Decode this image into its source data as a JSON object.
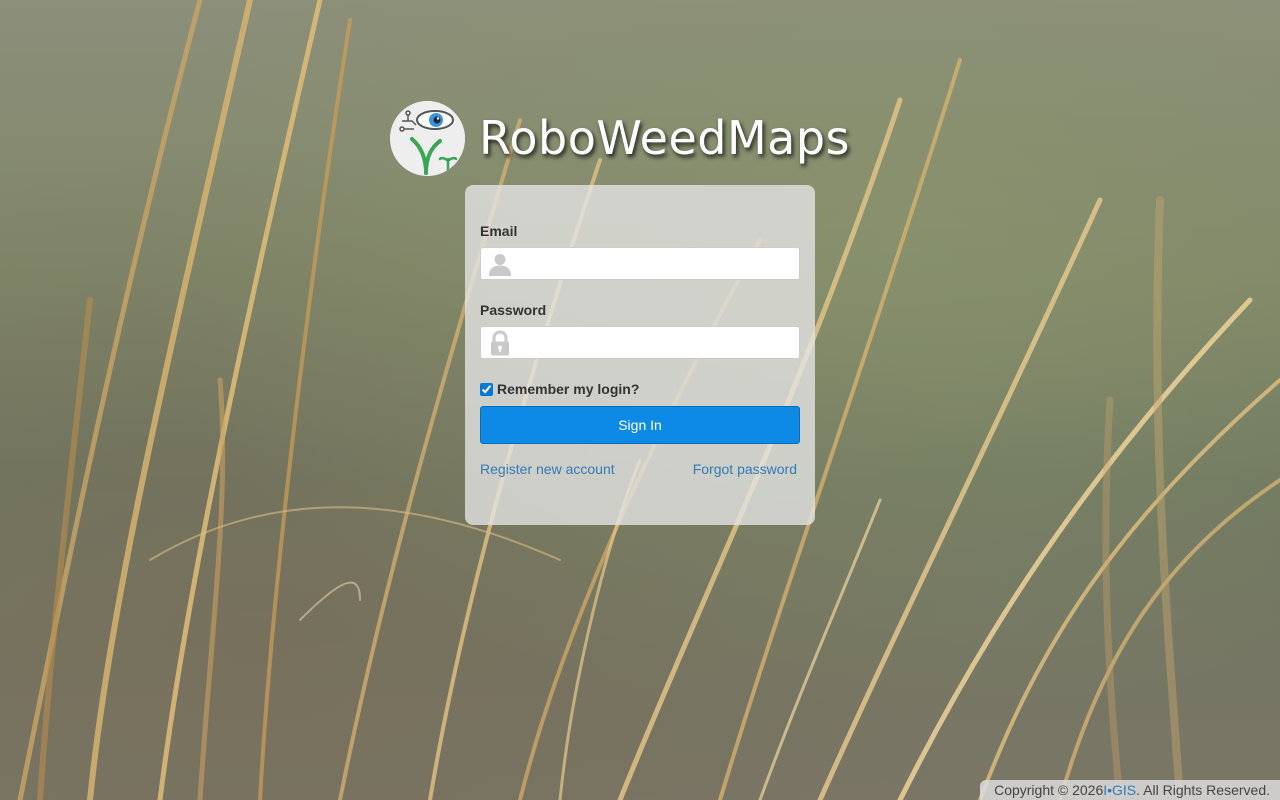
{
  "brand": {
    "title": "RoboWeedMaps",
    "logo_icon": "robot-eye-plant-logo"
  },
  "login": {
    "email_label": "Email",
    "email_value": "",
    "email_placeholder": "",
    "email_icon": "user-icon",
    "password_label": "Password",
    "password_value": "",
    "password_placeholder": "",
    "password_icon": "lock-icon",
    "remember_label": "Remember my login?",
    "remember_checked": true,
    "signin_label": "Sign In",
    "register_link": "Register new account",
    "forgot_link": "Forgot password"
  },
  "footer": {
    "prefix": "Copyright © 2026 ",
    "company": "I•GIS",
    "suffix": ". All Rights Reserved."
  },
  "colors": {
    "primary_button": "#0d8ae6",
    "link": "#337ab7",
    "card_bg": "rgba(230,230,230,0.78)",
    "text": "#333333"
  }
}
